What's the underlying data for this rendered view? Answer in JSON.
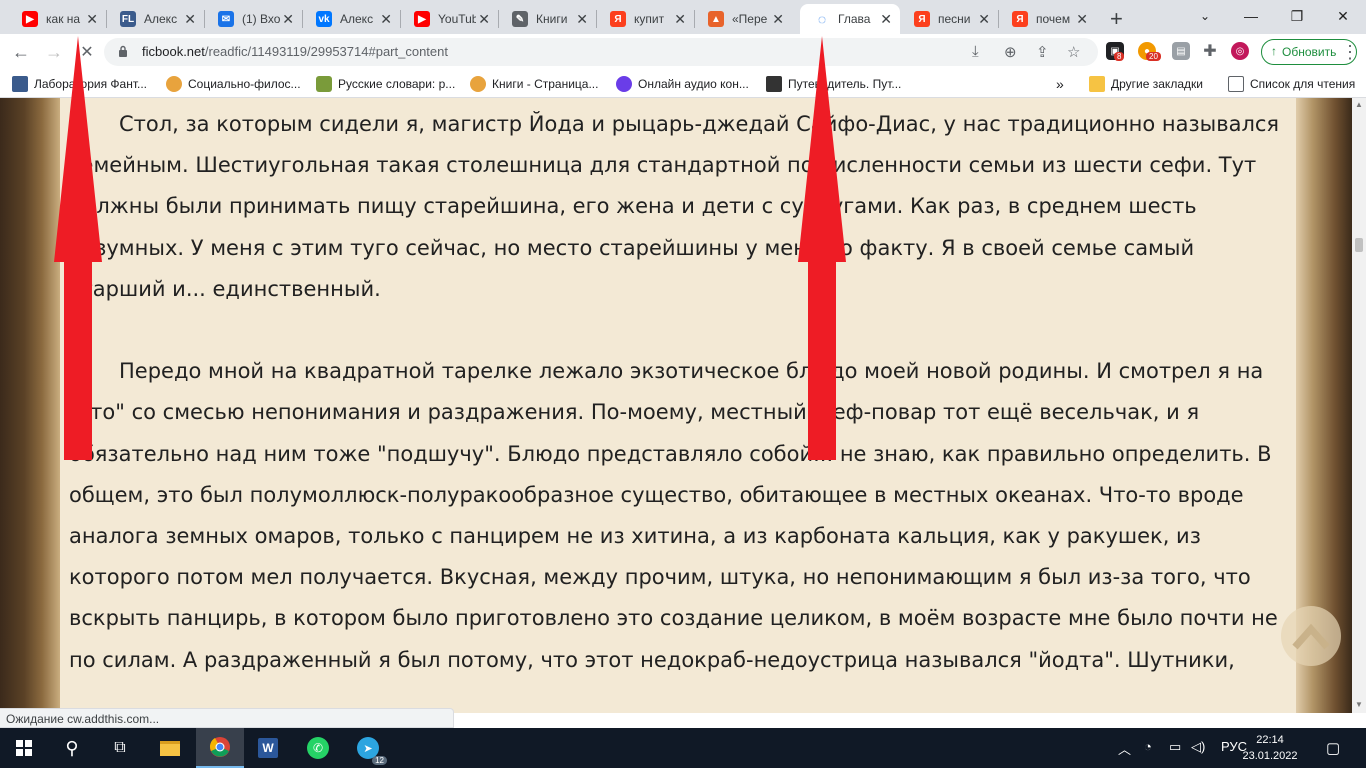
{
  "colors": {
    "tabstrip": "#dee1e6",
    "page_bg": "#f3e9d5",
    "text": "#212121",
    "red_arrow": "#ee1c25",
    "update_green": "#1e8e3e",
    "taskbar": "#101926"
  },
  "tabs": [
    {
      "title": "как на",
      "icon": "youtube-icon",
      "active": false
    },
    {
      "title": "Алекс",
      "icon": "ficbook-icon",
      "active": false
    },
    {
      "title": "(1) Вхо",
      "icon": "mail-icon",
      "active": false
    },
    {
      "title": "Алекс",
      "icon": "vk-icon",
      "active": false
    },
    {
      "title": "YouTub",
      "icon": "youtube-icon",
      "active": false
    },
    {
      "title": "Книги",
      "icon": "books-icon",
      "active": false
    },
    {
      "title": "купит",
      "icon": "yandex-icon",
      "active": false
    },
    {
      "title": "«Пере",
      "icon": "ficbook-icon",
      "active": false
    },
    {
      "title": "Глава",
      "icon": "loading-icon",
      "active": true
    },
    {
      "title": "песни",
      "icon": "yandex-icon",
      "active": false
    },
    {
      "title": "почем",
      "icon": "yandex-icon",
      "active": false
    }
  ],
  "address": {
    "host": "ficbook.net",
    "path": "/readfic/11493119/29953714#part_content"
  },
  "extensions": {
    "badge1": "8",
    "badge2": "20"
  },
  "update_label": "Обновить",
  "bookmarks": [
    "Лаборатория Фант...",
    "Социально-филос...",
    "Русские словари: р...",
    "Книги - Страница...",
    "Онлайн аудио кон...",
    "Путеводитель. Пут..."
  ],
  "bookmarks_more": "»",
  "bookmarks_other": "Другие закладки",
  "reading_list": "Список для чтения",
  "paragraphs": [
    "Стол, за которым сидели я, магистр Йода и рыцарь-джедай Сайфо-Диас, у нас традиционно назывался семейным. Шестиугольная такая столешница для стандартной по численности семьи из шести сефи. Тут должны были принимать пищу старейшина, его жена и дети с супругами. Как раз, в среднем шесть разумных. У меня с этим туго сейчас, но место старейшины у меня по факту. Я в своей семье самый старший и... единственный.",
    "Передо мной на квадратной тарелке лежало экзотическое блюдо моей новой родины. И смотрел я на \"это\" со смесью непонимания и раздражения. По-моему, местный шеф-повар тот ещё весельчак, и я обязательно над ним тоже \"подшучу\". Блюдо представляло собой... не знаю, как правильно определить. В общем, это был полумоллюск-полуракообразное существо, обитающее в местных океанах. Что-то вроде аналога земных омаров, только с панцирем не из хитина, а из карбоната кальция, как у ракушек, из которого потом мел получается. Вкусная, между прочим, штука, но непонимающим я был из-за того, что вскрыть панцирь, в котором было приготовлено это создание целиком, в моём возрасте мне было почти не по силам. А раздраженный я был потому, что этот недокраб-недоустрица назывался \"йодта\". Шутники,"
  ],
  "status_text": "Ожидание cw.addthis.com...",
  "tray": {
    "lang": "РУС",
    "time": "22:14",
    "date": "23.01.2022",
    "telegram_badge": "12"
  }
}
